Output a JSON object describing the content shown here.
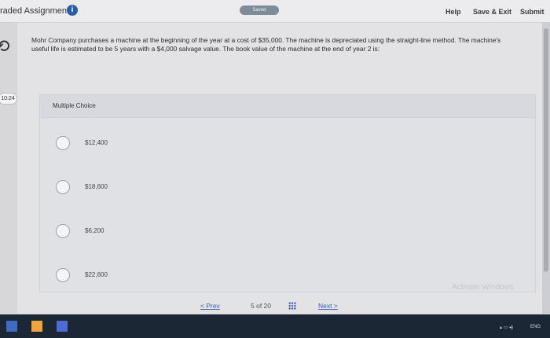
{
  "header": {
    "title": "raded Assignment",
    "saved": "Saved",
    "help": "Help",
    "save_exit": "Save & Exit",
    "submit": "Submit"
  },
  "left": {
    "timer": "10:24"
  },
  "question": {
    "text": "Mohr Company purchases a machine at the beginning of the year at a cost of $35,000. The machine is depreciated using the straight-line method. The machine's useful life is estimated to be 5 years with a $4,000 salvage value. The book value of the machine at the end of year 2 is:"
  },
  "choices": {
    "label": "Multiple Choice",
    "options": [
      {
        "label": "$12,400"
      },
      {
        "label": "$18,600"
      },
      {
        "label": "$6,200"
      },
      {
        "label": "$22,600"
      }
    ]
  },
  "pagination": {
    "prev": "< Prev",
    "count": "5 of 20",
    "next": "Next >"
  },
  "watermark": "Activate Windows",
  "taskbar": {
    "lang": "ENG"
  }
}
